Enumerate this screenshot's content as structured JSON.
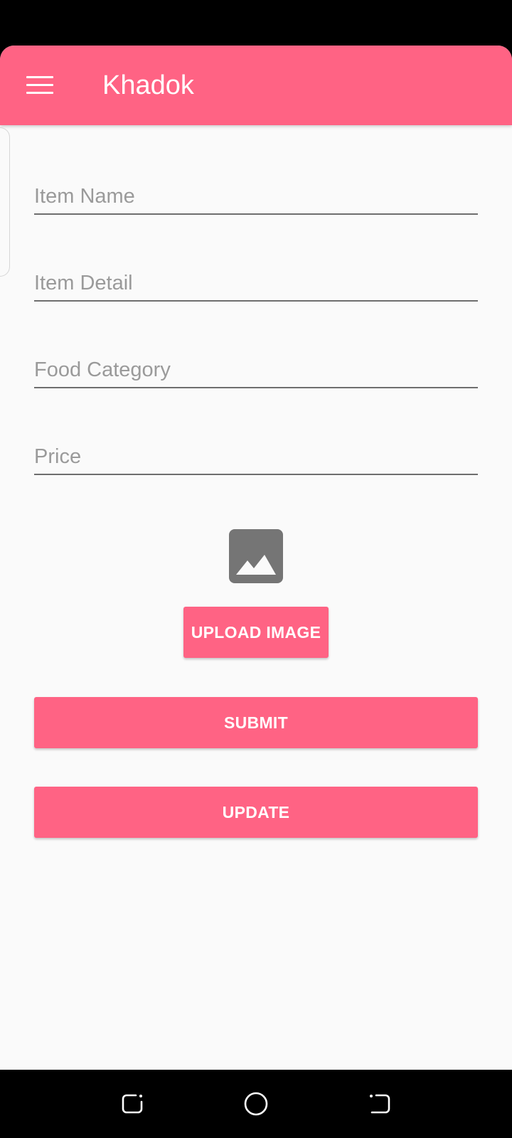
{
  "app_bar": {
    "title": "Khadok",
    "menu_icon": "hamburger-menu-icon"
  },
  "form": {
    "item_name": {
      "placeholder": "Item Name",
      "value": ""
    },
    "item_detail": {
      "placeholder": "Item Detail",
      "value": ""
    },
    "food_category": {
      "placeholder": "Food Category",
      "value": ""
    },
    "price": {
      "placeholder": "Price",
      "value": ""
    },
    "image_icon": "image-placeholder-icon",
    "upload_label": "UPLOAD IMAGE",
    "submit_label": "SUBMIT",
    "update_label": "UPDATE"
  },
  "system_nav": {
    "recents_icon": "recent-apps-icon",
    "home_icon": "home-circle-icon",
    "back_icon": "back-icon"
  },
  "colors": {
    "accent": "#ff6384",
    "background": "#fafafa",
    "icon_gray": "#757575"
  }
}
